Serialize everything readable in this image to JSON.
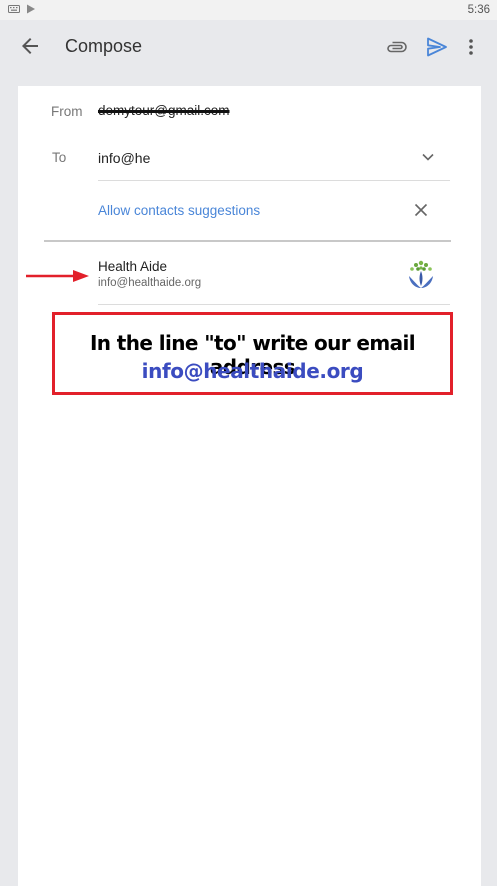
{
  "status_bar": {
    "time": "5:36",
    "icons": [
      "keyboard-icon",
      "play-store-icon"
    ]
  },
  "app_bar": {
    "title": "Compose",
    "icons": [
      "back-arrow-icon",
      "paperclip-icon",
      "send-icon",
      "more-vert-icon"
    ]
  },
  "compose": {
    "from_label": "From",
    "from_value": "demytour@gmail.com",
    "to_label": "To",
    "to_value": "info@he",
    "allow_contacts_label": "Allow contacts suggestions"
  },
  "suggestion": {
    "name": "Health Aide",
    "email": "info@healthaide.org"
  },
  "callout": {
    "line1": "In the line \"to\" write our email address",
    "line2": "info@healthaide.org"
  },
  "colors": {
    "accent": "#4a86d8",
    "callout_border": "#e2202a",
    "callout_link": "#3b4cc0",
    "background": "#e8e9ec"
  }
}
